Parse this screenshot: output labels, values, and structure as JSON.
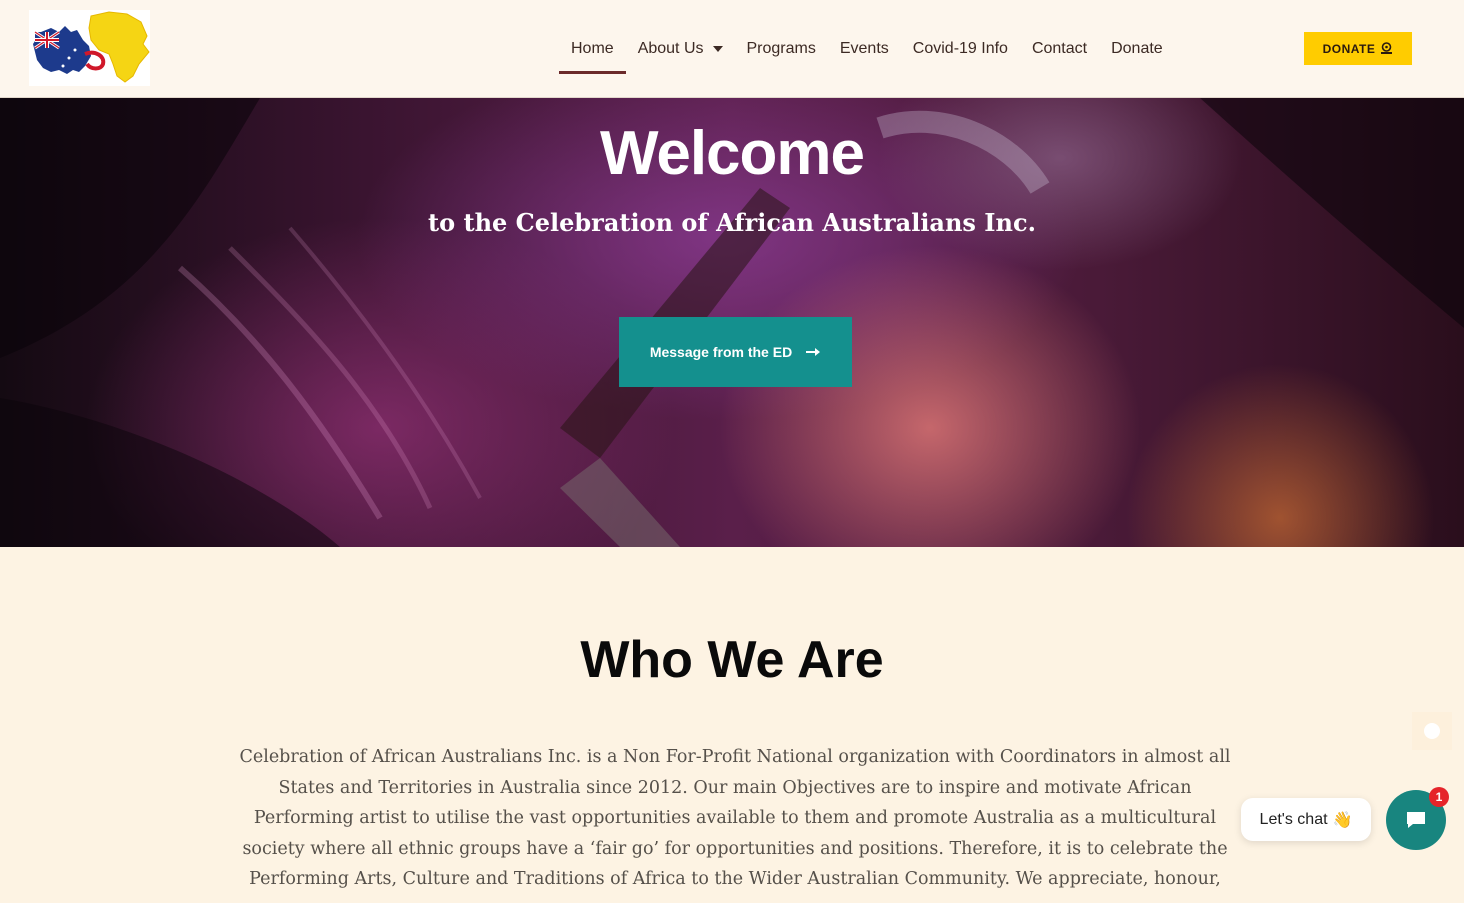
{
  "header": {
    "logo_alt": "Celebration of African Australians logo",
    "nav": [
      {
        "label": "Home",
        "active": true
      },
      {
        "label": "About Us",
        "has_dropdown": true
      },
      {
        "label": "Programs"
      },
      {
        "label": "Events"
      },
      {
        "label": "Covid-19 Info"
      },
      {
        "label": "Contact"
      },
      {
        "label": "Donate"
      }
    ],
    "donate_button": {
      "label": "DONATE",
      "icon": "coin-hand-icon"
    }
  },
  "hero": {
    "title": "Welcome",
    "subtitle": "to the Celebration of African Australians Inc.",
    "cta_label": "Message from the ED",
    "cta_icon": "arrow-right-icon"
  },
  "about": {
    "title": "Who We Are",
    "body": "Celebration of African Australians Inc. is a Non For-Profit National organization with Coordinators in almost all States and Territories in Australia since 2012. Our main Objectives are to inspire and motivate African Performing artist to utilise the vast opportunities available to them and promote Australia as a multicultural society where all ethnic groups have a ‘fair go’ for opportunities and positions. Therefore, it is to celebrate the Performing Arts, Culture and Traditions of Africa to the Wider Australian Community. We appreciate, honour,"
  },
  "chat": {
    "bubble_text": "Let's chat",
    "bubble_emoji": "👋",
    "badge_count": "1"
  },
  "colors": {
    "header_bg": "#fdf6ed",
    "page_bg": "#fdf3e3",
    "nav_active_underline": "#6b2a2a",
    "donate_yellow": "#ffcc00",
    "cta_teal": "#14908e",
    "chat_teal": "#18857f",
    "badge_red": "#e5242a"
  }
}
